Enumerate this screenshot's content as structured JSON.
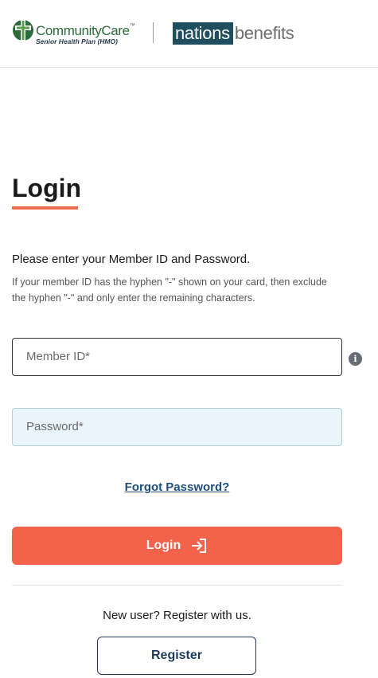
{
  "header": {
    "brand_name_community": "Community",
    "brand_name_care": "Care",
    "brand_trademark": "™",
    "brand_subtitle": "Senior Health Plan (HMO)",
    "partner_name_boxed": "nations",
    "partner_name_plain": "benefits",
    "colors": {
      "brand_green": "#2d6a3b",
      "partner_teal": "#1f4e5f"
    }
  },
  "login": {
    "title": "Login",
    "instruction": "Please enter your Member ID and Password.",
    "help_text": "If your member ID has the hyphen \"-\" shown on your card, then exclude the hyphen \"-\" and only enter the remaining characters.",
    "member_id_placeholder": "Member ID*",
    "member_id_info_icon": "info-icon",
    "password_placeholder": "Password*",
    "forgot_password": "Forgot Password?",
    "login_button": "Login",
    "login_button_icon": "sign-in-icon",
    "accent_color": "#f3624b"
  },
  "register": {
    "prompt": "New user? Register with us.",
    "button": "Register"
  }
}
